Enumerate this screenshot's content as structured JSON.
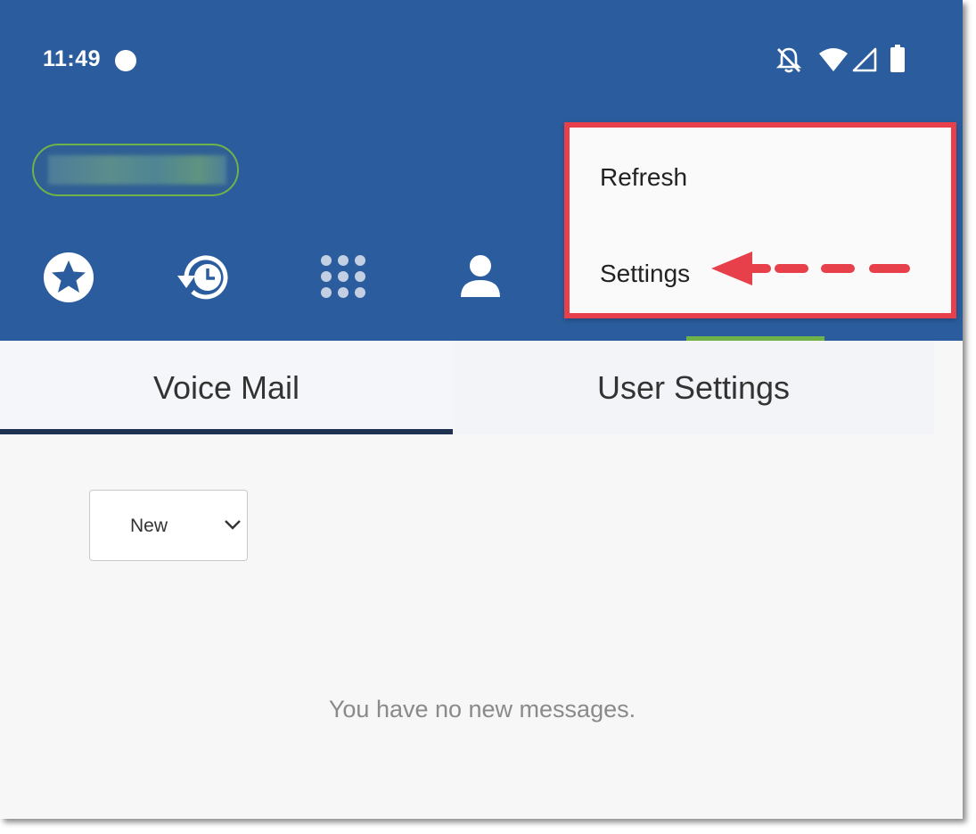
{
  "status_bar": {
    "time": "11:49",
    "icons": [
      "record-dot-icon",
      "notifications-off-icon",
      "wifi-icon",
      "signal-icon",
      "battery-icon"
    ]
  },
  "header": {
    "account_pill_label": "",
    "nav_icons": [
      "favorites-star-icon",
      "history-icon",
      "dialpad-icon",
      "contacts-icon"
    ]
  },
  "overflow_menu": {
    "items": [
      {
        "label": "Refresh"
      },
      {
        "label": "Settings"
      }
    ]
  },
  "tabs": [
    {
      "label": "Voice Mail",
      "selected": true
    },
    {
      "label": "User Settings",
      "selected": false
    }
  ],
  "filter": {
    "selected": "New"
  },
  "messages": {
    "empty_text": "You have no new messages."
  },
  "colors": {
    "header_bg": "#2b5d9e",
    "accent_green": "#6fb24a",
    "annotation_red": "#e8404a",
    "tab_underline": "#1f3252"
  }
}
